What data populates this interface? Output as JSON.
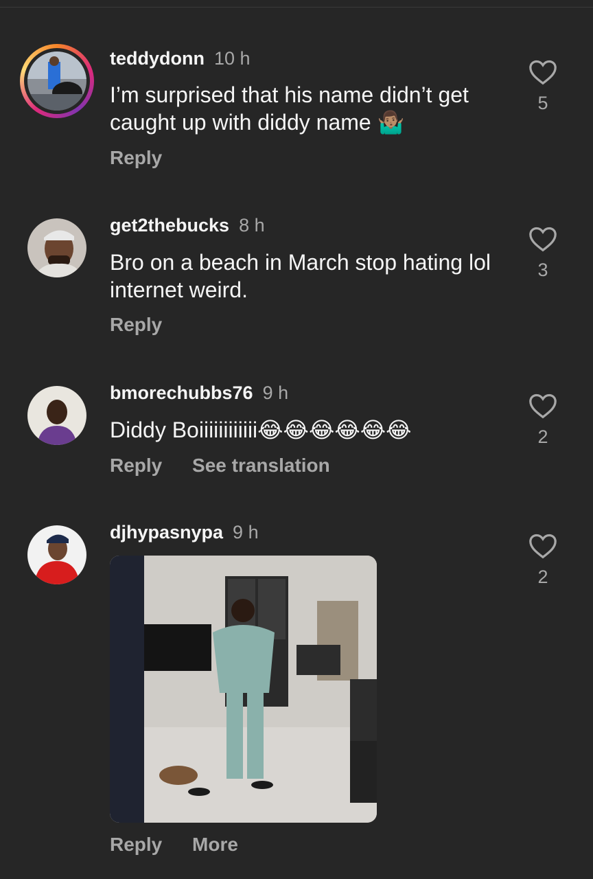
{
  "comments": [
    {
      "username": "teddydonn",
      "time": "10 h",
      "text": "I’m surprised that his name didn’t get caught up with diddy name 🤷🏽‍♂️",
      "reply_label": "Reply",
      "likes": "5"
    },
    {
      "username": "get2thebucks",
      "time": "8 h",
      "text": "Bro on a beach in March stop hating lol internet weird.",
      "reply_label": "Reply",
      "likes": "3"
    },
    {
      "username": "bmorechubbs76",
      "time": "9 h",
      "text": "Diddy Boiiiiiiiiiiii😂😂😂😂😂😂",
      "reply_label": "Reply",
      "translate_label": "See translation",
      "likes": "2"
    },
    {
      "username": "djhypasnypa",
      "time": "9 h",
      "reply_label": "Reply",
      "more_label": "More",
      "likes": "2"
    }
  ],
  "colors": {
    "background": "#262626",
    "text_primary": "#f5f5f5",
    "text_secondary": "#a8a8a8"
  },
  "icons": {
    "like": "heart-outline-icon"
  }
}
